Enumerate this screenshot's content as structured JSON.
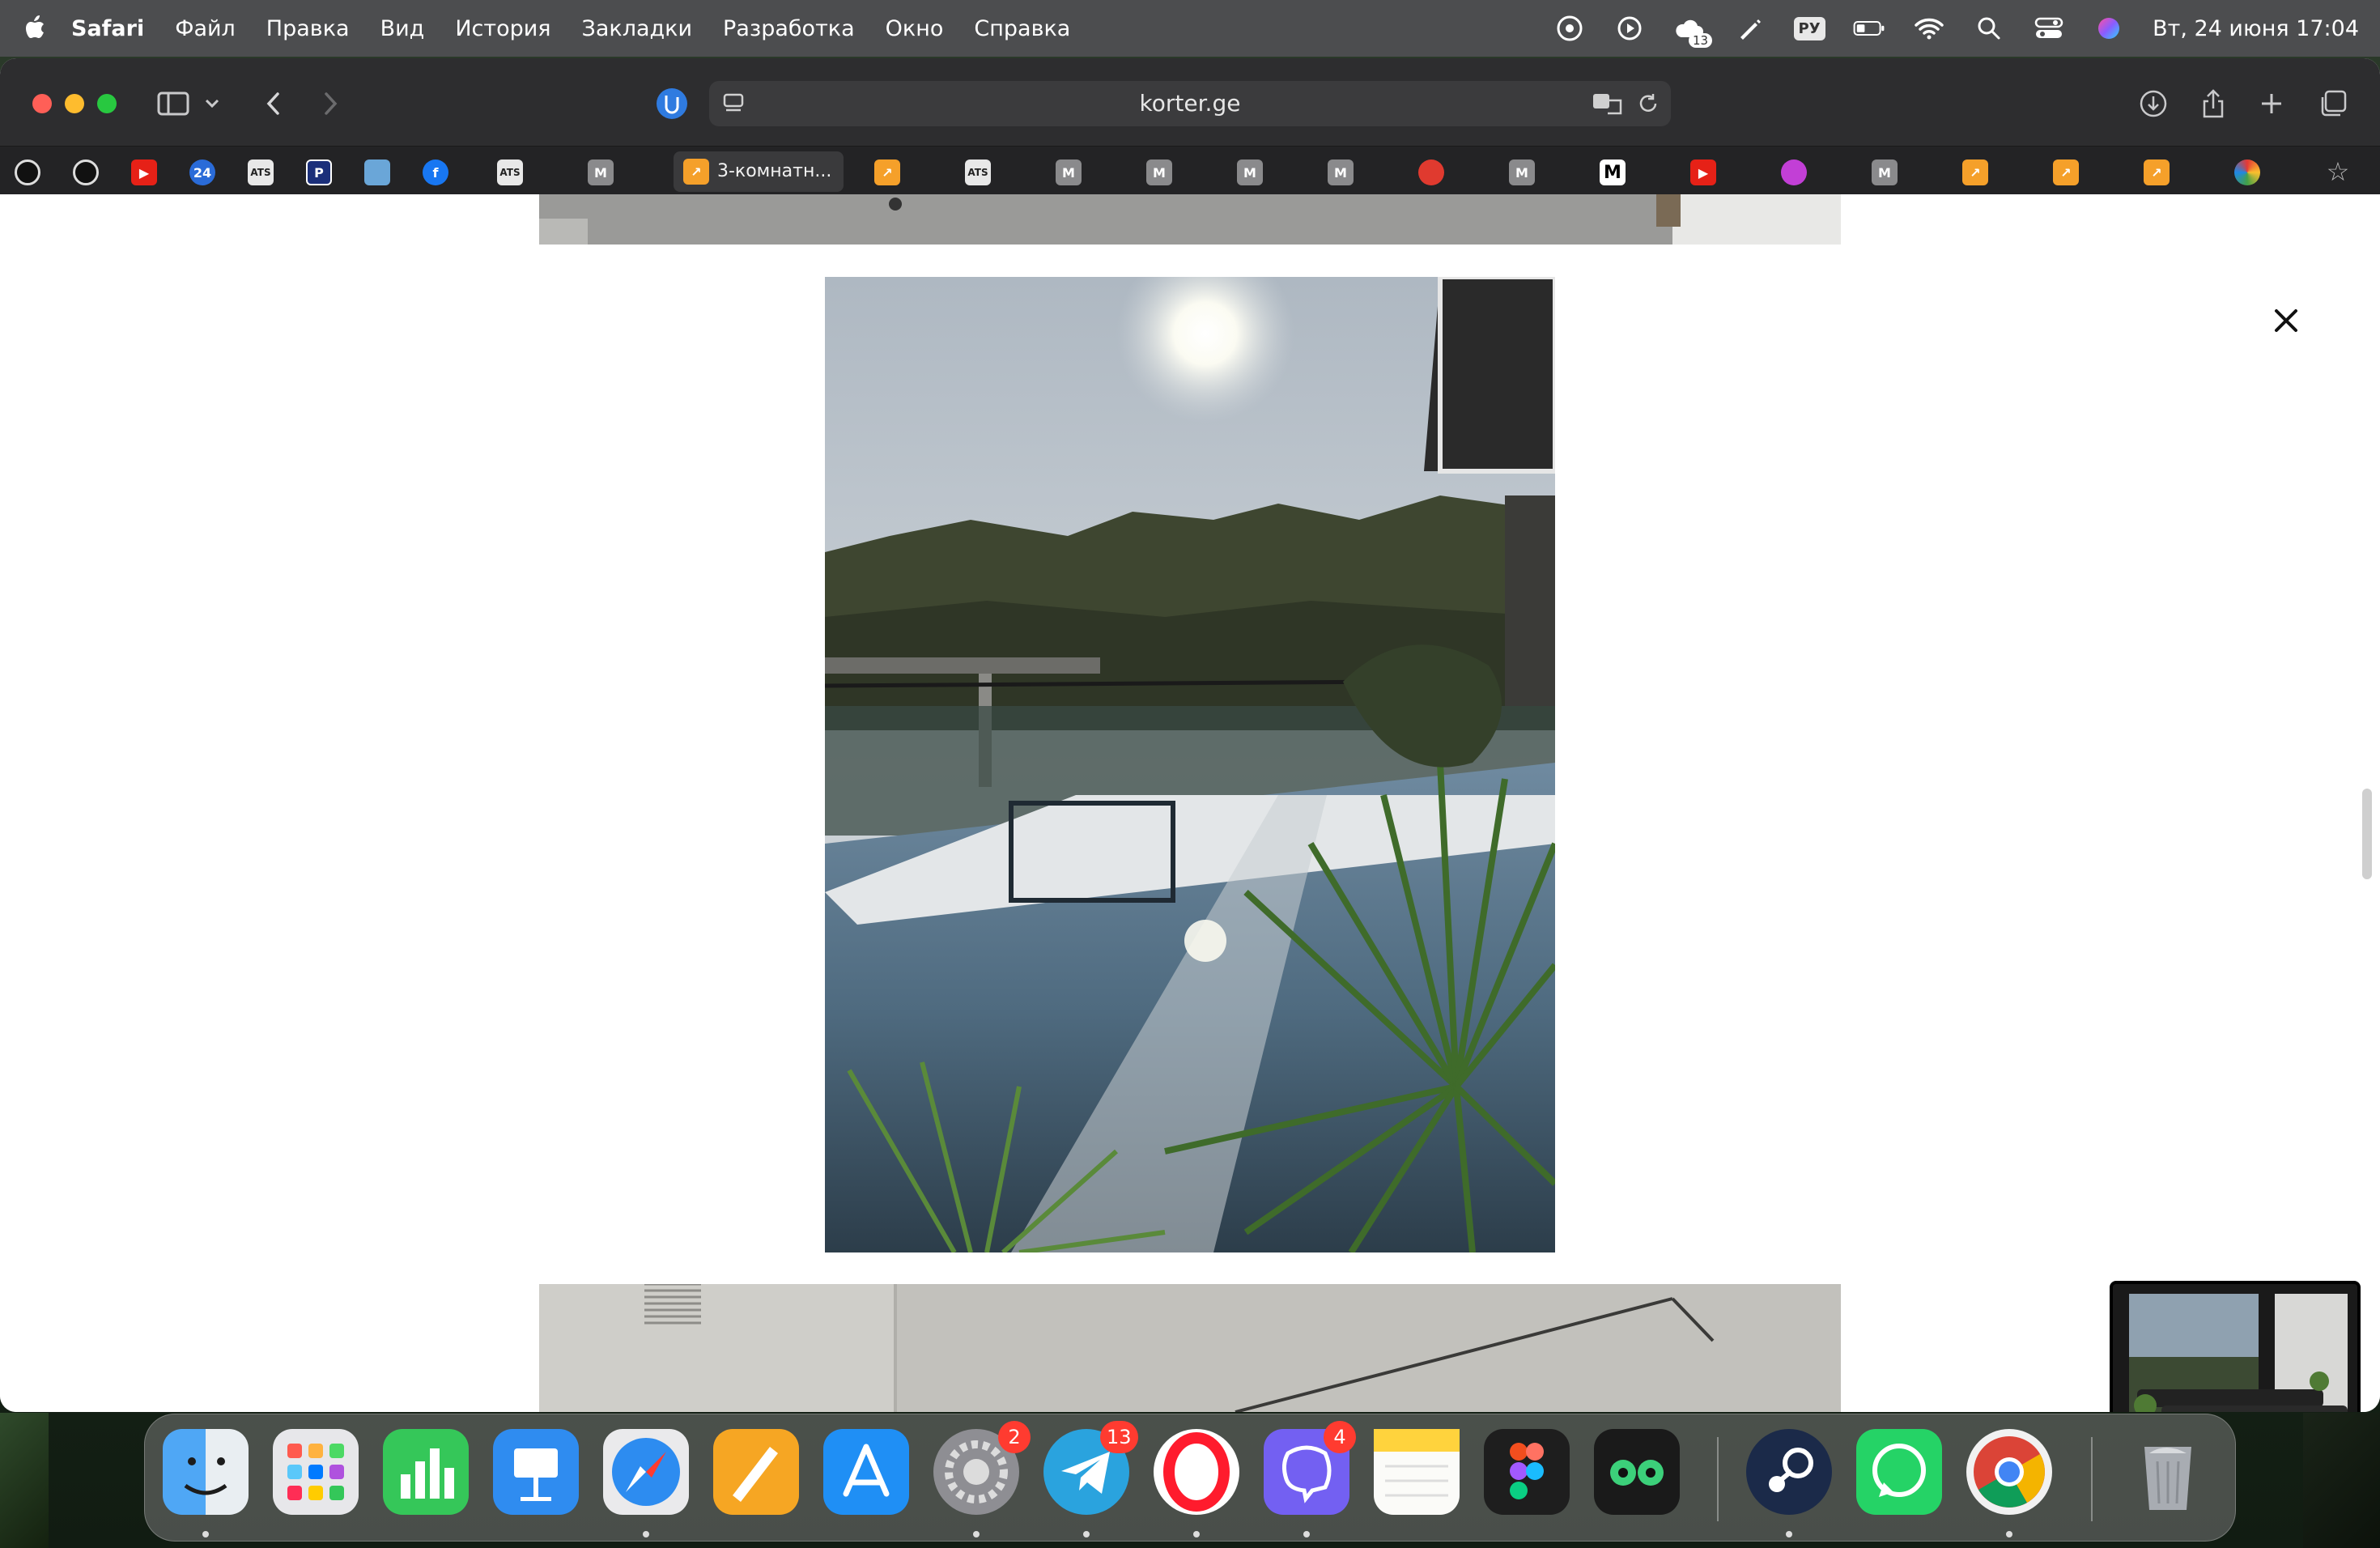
{
  "menubar": {
    "app_name": "Safari",
    "items": [
      "Файл",
      "Правка",
      "Вид",
      "История",
      "Закладки",
      "Разработка",
      "Окно",
      "Справка"
    ],
    "keyboard_layout": "РУ",
    "notification_count": "13",
    "clock": "Вт, 24 июня  17:04"
  },
  "browser": {
    "url": "korter.ge",
    "active_tab_label": "3-комнатн...",
    "bookmark_m_label": "M",
    "bookmark_24_label": "24",
    "bookmark_ats_label": "ATS",
    "bookmark_p_label": "P",
    "bookmark_f_label": "f"
  },
  "dock": {
    "badges": {
      "settings": "2",
      "telegram": "13",
      "viber": "4"
    }
  },
  "colors": {
    "menubar": "#4c4d4f",
    "toolbar": "#2d2d2f",
    "bookmarks_bar": "#232325",
    "badge_red": "#ff3b30"
  }
}
